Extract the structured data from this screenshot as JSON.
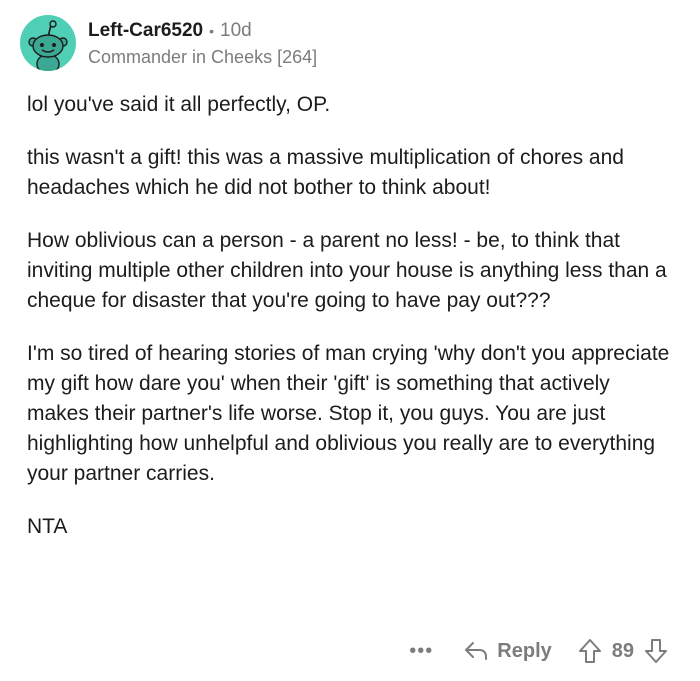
{
  "comment": {
    "author": "Left-Car6520",
    "separator": "•",
    "age": "10d",
    "flair": "Commander in Cheeks [264]",
    "avatar_icon": "reddit-snoo-avatar",
    "avatar_color": "#4fd0b6",
    "paragraphs": [
      "lol you've said it all perfectly, OP.",
      "this wasn't a gift! this was a massive multiplication of chores and headaches which he did not bother to think about!",
      "How oblivious can a person - a parent no less! - be, to think that inviting multiple other children into your house is anything less than a cheque for disaster that you're going to have pay out???",
      "I'm so tired of hearing stories of man crying 'why don't you appreciate my gift how dare you' when their 'gift' is something that actively makes their partner's life worse. Stop it, you guys. You are just highlighting how unhelpful and oblivious you really are to everything your partner carries.",
      "NTA"
    ]
  },
  "actions": {
    "more_label": "•••",
    "reply_label": "Reply",
    "reply_icon": "reply-arrow-icon",
    "upvote_icon": "upvote-arrow-icon",
    "vote_count": "89",
    "downvote_icon": "downvote-arrow-icon"
  }
}
